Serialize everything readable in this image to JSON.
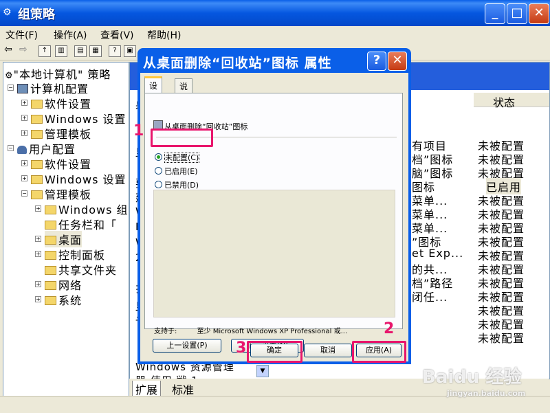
{
  "main_window": {
    "title": "组策略",
    "menu": [
      "文件(F)",
      "操作(A)",
      "查看(V)",
      "帮助(H)"
    ],
    "buttons": {
      "minimize": "_",
      "maximize": "□",
      "close": "✕"
    }
  },
  "tree": {
    "items": [
      {
        "label": "\"本地计算机\" 策略",
        "level": 0
      },
      {
        "label": "计算机配置",
        "level": 1
      },
      {
        "label": "软件设置",
        "level": 2
      },
      {
        "label": "Windows 设置",
        "level": 2
      },
      {
        "label": "管理模板",
        "level": 2
      },
      {
        "label": "用户配置",
        "level": 1
      },
      {
        "label": "软件设置",
        "level": 2
      },
      {
        "label": "Windows 设置",
        "level": 2
      },
      {
        "label": "管理模板",
        "level": 2
      },
      {
        "label": "Windows 组",
        "level": 3
      },
      {
        "label": "任务栏和「",
        "level": 3
      },
      {
        "label": "桌面",
        "level": 3
      },
      {
        "label": "控制面板",
        "level": 3
      },
      {
        "label": "共享文件夹",
        "level": 3
      },
      {
        "label": "网络",
        "level": 3
      },
      {
        "label": "系统",
        "level": 3
      }
    ]
  },
  "right_pane": {
    "status_header": "状态",
    "rows": [
      {
        "setting": "有项目",
        "status": "未被配置"
      },
      {
        "setting": "档”图标",
        "status": "未被配置"
      },
      {
        "setting": "脑”图标",
        "status": "未被配置"
      },
      {
        "setting": "图标",
        "status": "已启用"
      },
      {
        "setting": "菜单...",
        "status": "未被配置"
      },
      {
        "setting": "菜单...",
        "status": "未被配置"
      },
      {
        "setting": "菜单...",
        "status": "未被配置"
      },
      {
        "setting": "”图标",
        "status": "未被配置"
      },
      {
        "setting": "et Exp...",
        "status": "未被配置"
      },
      {
        "setting": "的共...",
        "status": "未被配置"
      },
      {
        "setting": "档”路径",
        "status": "未被配置"
      },
      {
        "setting": "闭任...",
        "status": "未被配置"
      },
      {
        "setting": "",
        "status": "未被配置"
      },
      {
        "setting": "",
        "status": "未被配置"
      },
      {
        "setting": "",
        "status": "未被配置"
      }
    ],
    "left_chars": [
      "桌",
      "显",
      "要",
      "建",
      "W",
      "F",
      "W",
      "2",
      "扌",
      "显",
      "讠"
    ],
    "bottom_text_1": "Windows 资源管理",
    "bottom_text_2": "器 使用 戦 1",
    "bottom_tabs": [
      "扩展",
      "标准"
    ]
  },
  "dialog": {
    "title": "从桌面删除“回收站”图标 属性",
    "tabs": [
      "设置",
      "说明"
    ],
    "policy_name": "从桌面删除“回收站”图标",
    "options": [
      "未配置(C)",
      "已启用(E)",
      "已禁用(D)"
    ],
    "selected_option": "未配置(C)",
    "supported_label": "支持于:",
    "supported_value": "至少 Microsoft Windows XP Professional 或...",
    "prev_button": "上一设置(P)",
    "next_button": "下一设置(N)",
    "ok_button": "确定",
    "cancel_button": "取消",
    "apply_button": "应用(A)",
    "help_button": "?",
    "close_button": "✕"
  },
  "annotations": {
    "step1": "1",
    "step2": "2",
    "step3": "3",
    "highlight_color": "#E8166C"
  },
  "watermark": {
    "brand": "Baidu 经验",
    "url": "jingyan.baidu.com"
  }
}
